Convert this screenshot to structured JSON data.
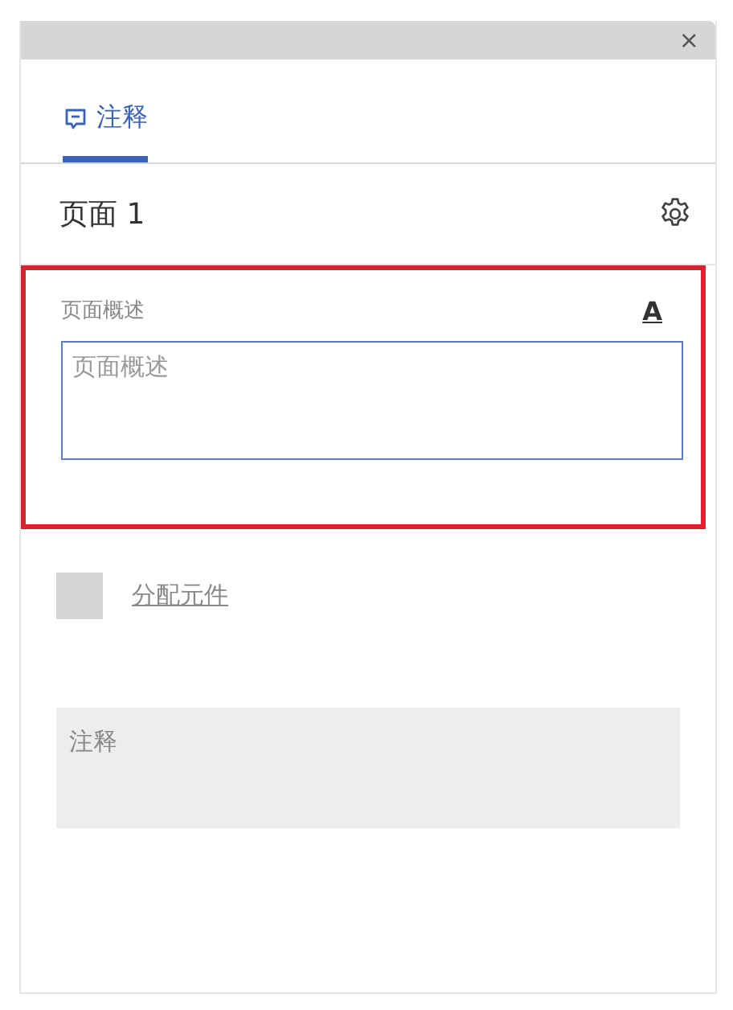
{
  "window": {
    "close": "×"
  },
  "tabs": [
    {
      "label": "注释",
      "selected": true
    }
  ],
  "page": {
    "title": "页面 1"
  },
  "description": {
    "label": "页面概述",
    "format_button": "A",
    "placeholder": "页面概述",
    "highlighted": true
  },
  "assign": {
    "label": "分配元件",
    "checked": false
  },
  "notes": {
    "placeholder": "注释"
  }
}
